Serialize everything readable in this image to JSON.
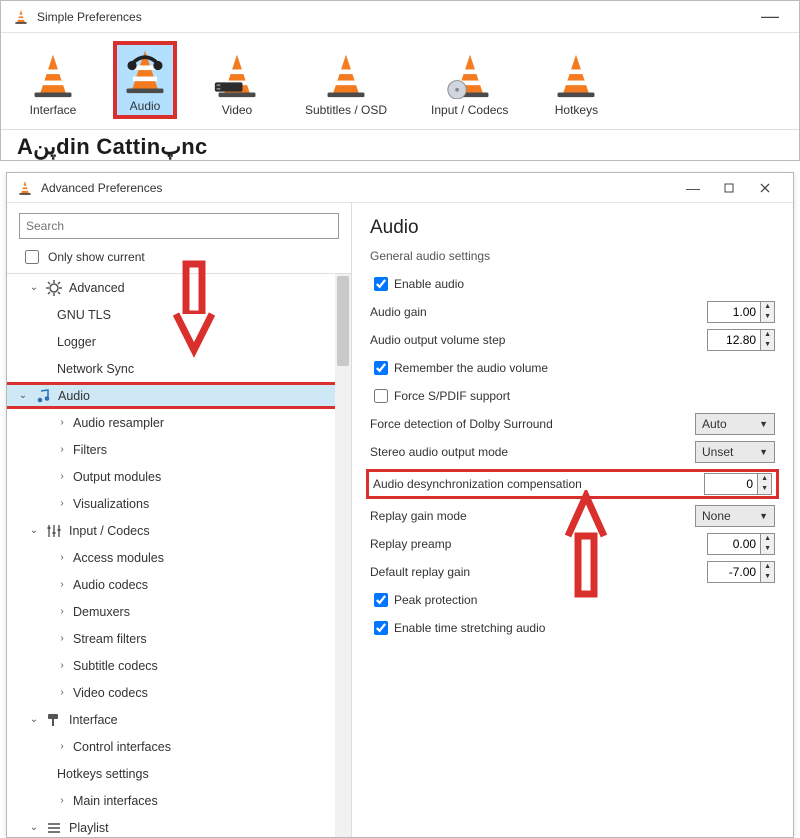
{
  "simple": {
    "title": "Simple Preferences",
    "truncated_heading": "Audio  Cattings",
    "tabs": [
      {
        "id": "interface",
        "label": "Interface"
      },
      {
        "id": "audio",
        "label": "Audio",
        "selected": true
      },
      {
        "id": "video",
        "label": "Video"
      },
      {
        "id": "subs",
        "label": "Subtitles / OSD"
      },
      {
        "id": "codecs",
        "label": "Input / Codecs"
      },
      {
        "id": "hotkeys",
        "label": "Hotkeys"
      }
    ]
  },
  "advanced": {
    "title": "Advanced Preferences",
    "search_placeholder": "Search",
    "only_show_current": {
      "label": "Only show current",
      "checked": false
    },
    "tree": {
      "advanced": {
        "label": "Advanced",
        "items": [
          "GNU TLS",
          "Logger",
          "Network Sync"
        ]
      },
      "audio": {
        "label": "Audio",
        "items": [
          "Audio resampler",
          "Filters",
          "Output modules",
          "Visualizations"
        ]
      },
      "input": {
        "label": "Input / Codecs",
        "items": [
          "Access modules",
          "Audio codecs",
          "Demuxers",
          "Stream filters",
          "Subtitle codecs",
          "Video codecs"
        ]
      },
      "interface": {
        "label": "Interface",
        "items": [
          "Control interfaces",
          "Hotkeys settings",
          "Main interfaces"
        ]
      },
      "playlist": {
        "label": "Playlist"
      }
    }
  },
  "panel": {
    "heading": "Audio",
    "subheading": "General audio settings",
    "enable_audio": {
      "label": "Enable audio",
      "checked": true
    },
    "audio_gain": {
      "label": "Audio gain",
      "value": "1.00"
    },
    "volume_step": {
      "label": "Audio output volume step",
      "value": "12.80"
    },
    "remember": {
      "label": "Remember the audio volume",
      "checked": true
    },
    "spdif": {
      "label": "Force S/PDIF support",
      "checked": false
    },
    "dolby": {
      "label": "Force detection of Dolby Surround",
      "value": "Auto"
    },
    "stereo": {
      "label": "Stereo audio output mode",
      "value": "Unset"
    },
    "desync": {
      "label": "Audio desynchronization compensation",
      "value": "0"
    },
    "replay_mode": {
      "label": "Replay gain mode",
      "value": "None"
    },
    "replay_preamp": {
      "label": "Replay preamp",
      "value": "0.00"
    },
    "default_gain": {
      "label": "Default replay gain",
      "value": "-7.00"
    },
    "peak": {
      "label": "Peak protection",
      "checked": true
    },
    "stretch": {
      "label": "Enable time stretching audio",
      "checked": true
    }
  }
}
